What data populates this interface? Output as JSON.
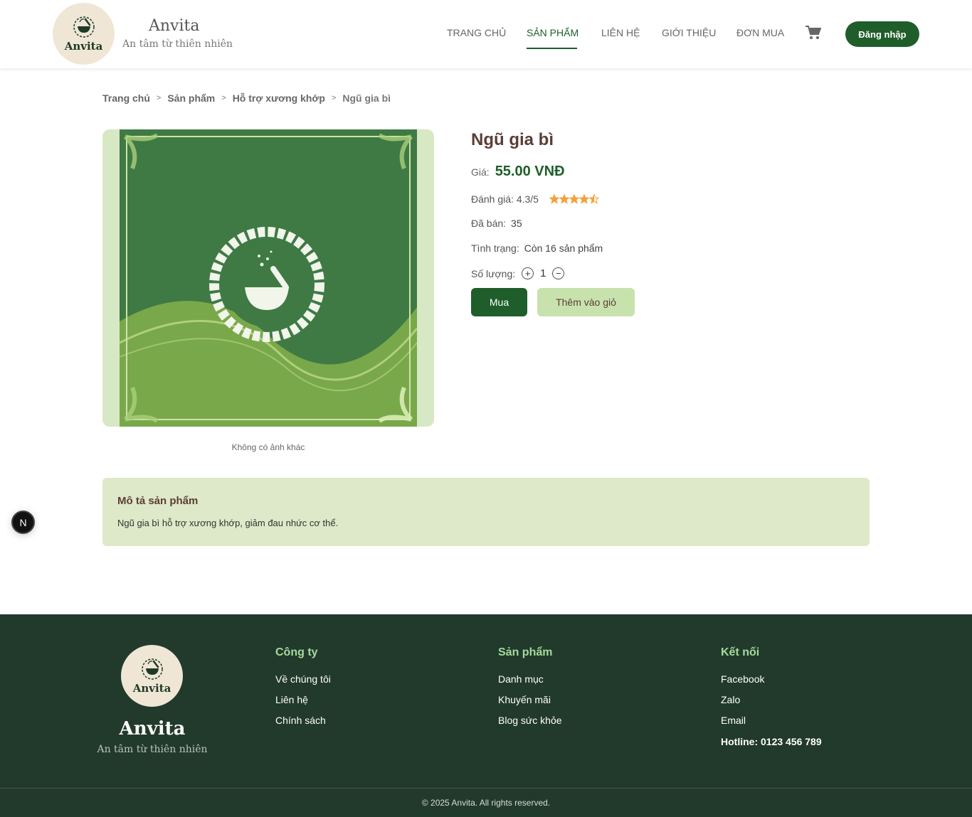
{
  "header": {
    "logo_text": "Anvita",
    "brand_name": "Anvita",
    "brand_tagline": "An tâm từ thiên nhiên",
    "nav": [
      "TRANG CHỦ",
      "SẢN PHẨM",
      "LIÊN HỆ",
      "GIỚI THIỆU",
      "ĐƠN MUA"
    ],
    "active_nav": "SẢN PHẨM",
    "cart_icon": "shopping-cart-icon",
    "login_label": "Đăng nhập"
  },
  "breadcrumb": [
    "Trang chủ",
    "Sản phẩm",
    "Hỗ trợ xương khớp",
    "Ngũ gia bì"
  ],
  "breadcrumb_separator": ">",
  "product": {
    "title": "Ngũ gia bì",
    "price_label": "Giá:",
    "price": "55.00 VNĐ",
    "rating_label": "Đánh giá: 4.3/5",
    "rating_value": 4.3,
    "rating_max": 5,
    "sold_label": "Đã bán:",
    "sold_value": "35",
    "status_label": "Tình trạng:",
    "status_value": "Còn 16 sản phẩm",
    "qty_label": "Số lượng:",
    "qty_value": "1",
    "qty_plus": "+",
    "qty_minus": "−",
    "buy_label": "Mua",
    "add_cart_label": "Thêm vào giỏ",
    "no_more_images": "Không có ảnh khác"
  },
  "description": {
    "title": "Mô tả sản phẩm",
    "text": "Ngũ gia bì hỗ trợ xương khớp, giảm đau nhức cơ thể."
  },
  "next_badge": "N",
  "footer": {
    "logo_text": "Anvita",
    "brand_name": "Anvita",
    "brand_tagline": "An tâm từ thiên nhiên",
    "col_company": {
      "title": "Công ty",
      "links": [
        "Về chúng tôi",
        "Liên hệ",
        "Chính sách"
      ]
    },
    "col_products": {
      "title": "Sản phẩm",
      "links": [
        "Danh mục",
        "Khuyến mãi",
        "Blog sức khỏe"
      ]
    },
    "col_connect": {
      "title": "Kết nối",
      "links": [
        "Facebook",
        "Zalo",
        "Email"
      ],
      "hotline": "Hotline: 0123 456 789"
    },
    "copyright": "© 2025 Anvita. All rights reserved."
  },
  "colors": {
    "primary": "#1f5e2a",
    "light_green": "#c8e2ad",
    "footer_bg": "#223a2c",
    "star": "#f2a23a"
  }
}
